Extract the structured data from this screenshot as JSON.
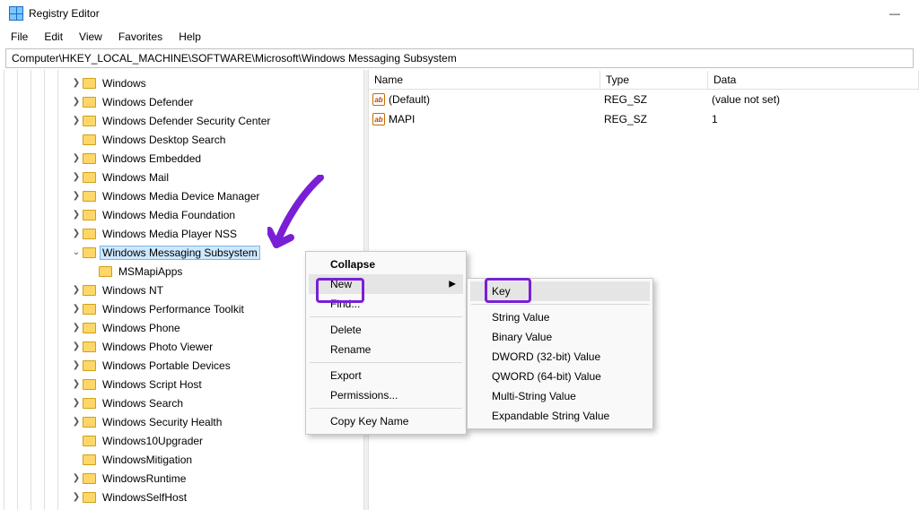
{
  "window": {
    "title": "Registry Editor"
  },
  "menubar": [
    "File",
    "Edit",
    "View",
    "Favorites",
    "Help"
  ],
  "path": "Computer\\HKEY_LOCAL_MACHINE\\SOFTWARE\\Microsoft\\Windows Messaging Subsystem",
  "tree": [
    {
      "label": "Windows",
      "exp": ">"
    },
    {
      "label": "Windows Defender",
      "exp": ">"
    },
    {
      "label": "Windows Defender Security Center",
      "exp": ">"
    },
    {
      "label": "Windows Desktop Search",
      "exp": ""
    },
    {
      "label": "Windows Embedded",
      "exp": ">"
    },
    {
      "label": "Windows Mail",
      "exp": ">"
    },
    {
      "label": "Windows Media Device Manager",
      "exp": ">"
    },
    {
      "label": "Windows Media Foundation",
      "exp": ">"
    },
    {
      "label": "Windows Media Player NSS",
      "exp": ">"
    },
    {
      "label": "Windows Messaging Subsystem",
      "exp": "v",
      "selected": true
    },
    {
      "label": "MSMapiApps",
      "exp": "",
      "child": true
    },
    {
      "label": "Windows NT",
      "exp": ">"
    },
    {
      "label": "Windows Performance Toolkit",
      "exp": ">"
    },
    {
      "label": "Windows Phone",
      "exp": ">"
    },
    {
      "label": "Windows Photo Viewer",
      "exp": ">"
    },
    {
      "label": "Windows Portable Devices",
      "exp": ">"
    },
    {
      "label": "Windows Script Host",
      "exp": ">"
    },
    {
      "label": "Windows Search",
      "exp": ">"
    },
    {
      "label": "Windows Security Health",
      "exp": ">"
    },
    {
      "label": "Windows10Upgrader",
      "exp": ""
    },
    {
      "label": "WindowsMitigation",
      "exp": ""
    },
    {
      "label": "WindowsRuntime",
      "exp": ">"
    },
    {
      "label": "WindowsSelfHost",
      "exp": ">"
    }
  ],
  "columns": {
    "name": "Name",
    "type": "Type",
    "data": "Data"
  },
  "values": [
    {
      "name": "(Default)",
      "type": "REG_SZ",
      "data": "(value not set)"
    },
    {
      "name": "MAPI",
      "type": "REG_SZ",
      "data": "1"
    }
  ],
  "ctx1": {
    "collapse": "Collapse",
    "new": "New",
    "find": "Find...",
    "delete": "Delete",
    "rename": "Rename",
    "export": "Export",
    "permissions": "Permissions...",
    "copykey": "Copy Key Name"
  },
  "ctx2": {
    "key": "Key",
    "string": "String Value",
    "binary": "Binary Value",
    "dword": "DWORD (32-bit) Value",
    "qword": "QWORD (64-bit) Value",
    "multi": "Multi-String Value",
    "expand": "Expandable String Value"
  }
}
